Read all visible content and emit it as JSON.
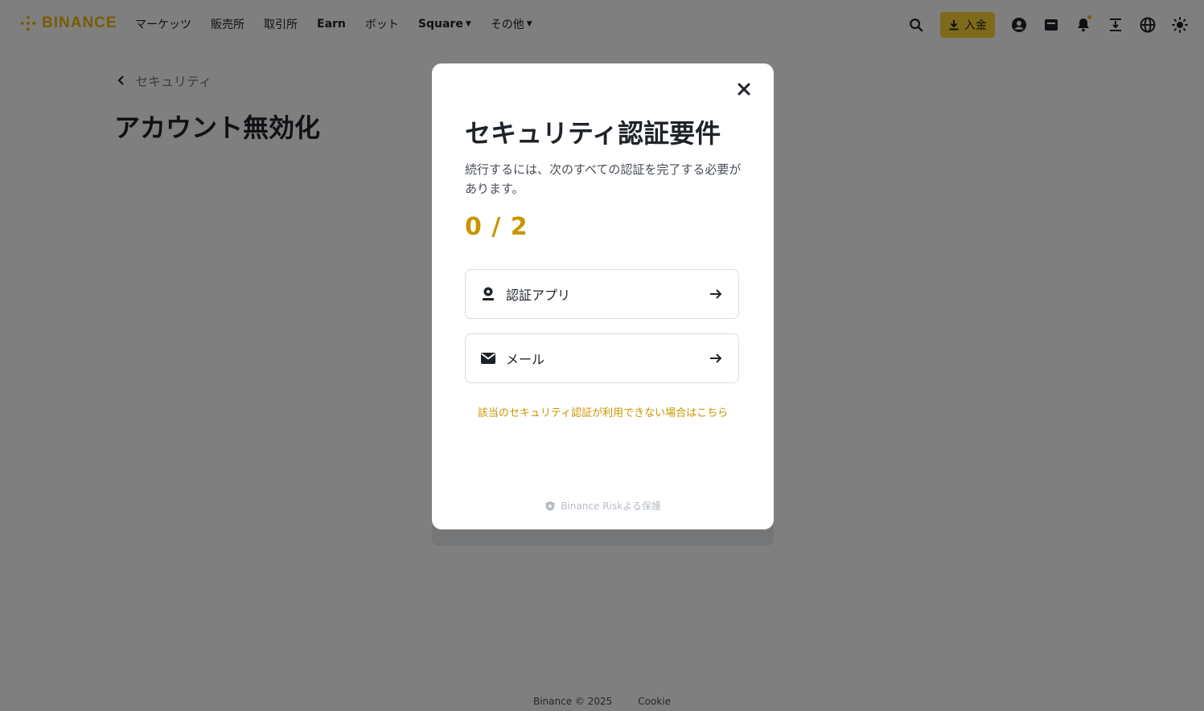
{
  "header": {
    "logo_text": "BINANCE",
    "nav": [
      {
        "label": "マーケッツ",
        "bold": false,
        "dropdown": false
      },
      {
        "label": "販売所",
        "bold": false,
        "dropdown": false
      },
      {
        "label": "取引所",
        "bold": false,
        "dropdown": false
      },
      {
        "label": "Earn",
        "bold": true,
        "dropdown": false
      },
      {
        "label": "ボット",
        "bold": false,
        "dropdown": false
      },
      {
        "label": "Square",
        "bold": true,
        "dropdown": true
      },
      {
        "label": "その他",
        "bold": false,
        "dropdown": true
      }
    ],
    "deposit_label": "入金",
    "icons": [
      "search-icon",
      "deposit-icon",
      "profile-icon",
      "orders-icon",
      "notification-icon",
      "download-app-icon",
      "language-icon",
      "theme-icon"
    ]
  },
  "page": {
    "back_label": "セキュリティ",
    "title": "アカウント無効化"
  },
  "modal": {
    "title": "セキュリティ認証要件",
    "description": "続行するには、次のすべての認証を完了する必要があります。",
    "progress": "0 / 2",
    "options": [
      {
        "label": "認証アプリ",
        "icon": "authenticator-icon"
      },
      {
        "label": "メール",
        "icon": "mail-icon"
      }
    ],
    "unavailable_link": "該当のセキュリティ認証が利用できない場合はこちら",
    "risk_text": "Binance Riskよる保護"
  },
  "footer": {
    "copyright": "Binance © 2025",
    "cookie": "Cookie"
  },
  "colors": {
    "brand": "#f0b90b",
    "accent_text": "#c99400",
    "overlay": "rgba(0,0,0,0.5)"
  }
}
